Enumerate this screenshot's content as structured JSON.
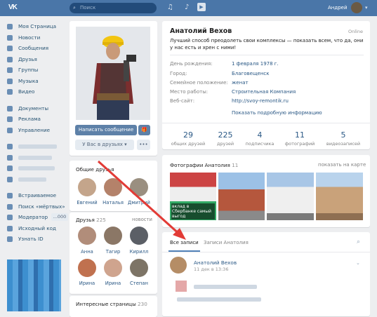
{
  "header": {
    "logo": "VK",
    "search_placeholder": "Поиск",
    "user_name": "Андрей",
    "icons": [
      "bell-icon",
      "music-icon",
      "play-icon"
    ]
  },
  "menu": {
    "items": [
      {
        "label": "Моя Страница",
        "icon": "user-icon"
      },
      {
        "label": "Новости",
        "icon": "news-icon"
      },
      {
        "label": "Сообщения",
        "icon": "messages-icon"
      },
      {
        "label": "Друзья",
        "icon": "friends-icon"
      },
      {
        "label": "Группы",
        "icon": "groups-icon"
      },
      {
        "label": "Музыка",
        "icon": "music-icon"
      },
      {
        "label": "Видео",
        "icon": "video-icon"
      }
    ],
    "items2": [
      {
        "label": "Документы",
        "icon": "documents-icon"
      },
      {
        "label": "Реклама",
        "icon": "ads-icon"
      },
      {
        "label": "Управление",
        "icon": "manage-icon"
      }
    ],
    "items4": [
      {
        "label": "Встраиваемое"
      },
      {
        "label": "Поиск «мёртвых»"
      },
      {
        "label": "Модератор",
        "badge": "...000"
      },
      {
        "label": "Исходный код"
      },
      {
        "label": "Узнать ID"
      }
    ]
  },
  "profile": {
    "name": "Анатолий Вехов",
    "online": "Online",
    "status": "Лучший способ преодолеть свои комплексы — показать всем, что да, они у нас есть и хрен с ними!",
    "fields": [
      {
        "label": "День рождения:",
        "value": "1 февраля 1978 г."
      },
      {
        "label": "Город:",
        "value": "Благовещенск"
      },
      {
        "label": "Семейное положение:",
        "value": "женат"
      },
      {
        "label": "Место работы:",
        "value": "Строительная Компания"
      },
      {
        "label": "Веб-сайт:",
        "value": "http://svoy-remontik.ru"
      }
    ],
    "show_more": "Показать подробную информацию",
    "stats": [
      {
        "n": "29",
        "t": "общих друзей"
      },
      {
        "n": "225",
        "t": "друзей"
      },
      {
        "n": "4",
        "t": "подписчика"
      },
      {
        "n": "11",
        "t": "фотографий"
      },
      {
        "n": "5",
        "t": "видеозаписей"
      }
    ]
  },
  "actions": {
    "message": "Написать сообщение",
    "friends": "У Вас в друзьях",
    "more": "•••"
  },
  "common_friends": {
    "title": "Общие друзья",
    "count": "29",
    "people": [
      "Евгений",
      "Наталья",
      "Дмитрий"
    ]
  },
  "friends": {
    "title": "Друзья",
    "count": "225",
    "news_link": "новости",
    "people": [
      "Анна",
      "Тагир",
      "Кирилл",
      "Ирина",
      "Ирина",
      "Степан"
    ]
  },
  "interesting": {
    "title": "Интересные страницы",
    "count": "230"
  },
  "photos": {
    "title": "Фотографии Анатолия",
    "count": "11",
    "map_link": "показать на карте",
    "caption": "вклад в Сбербанке самый выгод"
  },
  "wall": {
    "tab_all": "Все записи",
    "tab_own": "Записи Анатолия",
    "post_author": "Анатолий Вехов",
    "post_date": "11 дек в 13:36"
  },
  "colors": {
    "header": "#4a76a8",
    "link": "#2a5885",
    "button": "#5e81a8",
    "arrow": "#e23b36"
  }
}
